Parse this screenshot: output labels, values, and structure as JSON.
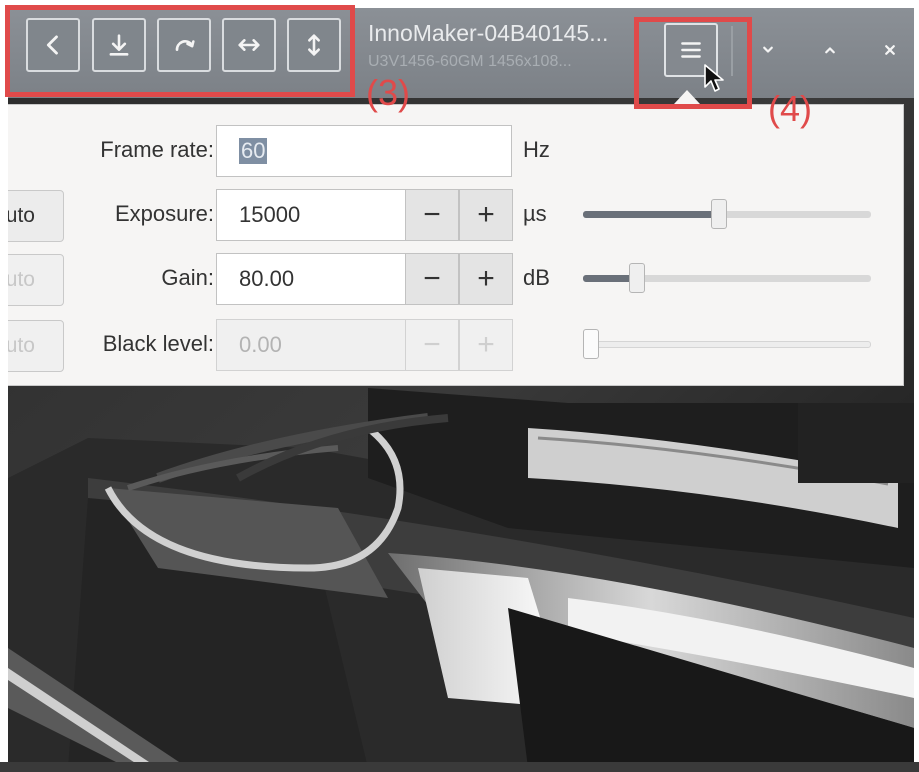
{
  "header": {
    "title": "InnoMaker-04B40145...",
    "subtitle": "U3V1456-60GM 1456x108..."
  },
  "toolbar": {
    "buttons": [
      {
        "icon": "back-icon"
      },
      {
        "icon": "download-icon"
      },
      {
        "icon": "rotate-icon"
      },
      {
        "icon": "flip-horizontal-icon"
      },
      {
        "icon": "flip-vertical-icon"
      }
    ],
    "menu_icon": "hamburger-menu-icon"
  },
  "window_controls": {
    "minimize_icon": "chevron-down-icon",
    "maximize_icon": "chevron-up-icon",
    "close_icon": "close-icon"
  },
  "annotations": {
    "toolbar_label": "(3)",
    "menu_label": "(4)",
    "color": "#e04a4a"
  },
  "controls": {
    "frame_rate": {
      "label": "Frame rate:",
      "value": "60",
      "unit": "Hz"
    },
    "exposure": {
      "label": "Exposure:",
      "value": "15000",
      "unit": "µs",
      "auto": "uto",
      "slider_fraction": 0.47
    },
    "gain": {
      "label": "Gain:",
      "value": "80.00",
      "unit": "dB",
      "auto": "uto",
      "slider_fraction": 0.17
    },
    "black_level": {
      "label": "Black level:",
      "value": "0.00",
      "unit": "",
      "auto": "uto",
      "slider_fraction": 0.0
    },
    "minus": "−",
    "plus": "+"
  },
  "colors": {
    "header": "#80868c",
    "popover": "#f6f5f4",
    "slider_fill": "#6a7079",
    "selection": "#7f8fa3"
  }
}
